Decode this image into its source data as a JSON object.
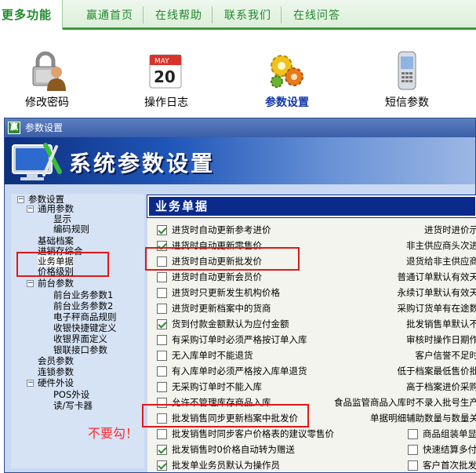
{
  "topnav": {
    "active": "更多功能",
    "items": [
      "赢通首页",
      "在线帮助",
      "联系我们",
      "在线问答"
    ]
  },
  "tools": [
    {
      "label": "修改密码",
      "icon": "lock-user-icon",
      "active": false
    },
    {
      "label": "操作日志",
      "icon": "calendar-icon",
      "active": false,
      "cal_month": "MAY",
      "cal_day": "20"
    },
    {
      "label": "参数设置",
      "icon": "gears-icon",
      "active": true
    },
    {
      "label": "短信参数",
      "icon": "mobile-phone-icon",
      "active": false
    }
  ],
  "window": {
    "title": "参数设置",
    "app_badge": "赢",
    "banner_title": "系统参数设置"
  },
  "tree": {
    "items": [
      {
        "label": "参数设置",
        "level": 0,
        "expander": "−"
      },
      {
        "label": "通用参数",
        "level": 1,
        "expander": "−"
      },
      {
        "label": "显示",
        "level": 2
      },
      {
        "label": "编码规则",
        "level": 2
      },
      {
        "label": "基础档案",
        "level": 1
      },
      {
        "label": "进销存综合",
        "level": 1
      },
      {
        "label": "业务单据",
        "level": 1,
        "selected": true
      },
      {
        "label": "价格级别",
        "level": 1
      },
      {
        "label": "前台参数",
        "level": 1,
        "expander": "−"
      },
      {
        "label": "前台业务参数1",
        "level": 2
      },
      {
        "label": "前台业务参数2",
        "level": 2
      },
      {
        "label": "电子秤商品规则",
        "level": 2
      },
      {
        "label": "收银快捷键定义",
        "level": 2
      },
      {
        "label": "收银界面定义",
        "level": 2
      },
      {
        "label": "银联接口参数",
        "level": 2
      },
      {
        "label": "会员参数",
        "level": 1
      },
      {
        "label": "连锁参数",
        "level": 1
      },
      {
        "label": "硬件外设",
        "level": 1,
        "expander": "−"
      },
      {
        "label": "POS外设",
        "level": 2
      },
      {
        "label": "读/写卡器",
        "level": 2
      }
    ]
  },
  "panel": {
    "header": "业务单据",
    "left_options": [
      {
        "label": "进货时自动更新参考进价",
        "checked": true
      },
      {
        "label": "进货时自动更新零售价",
        "checked": true
      },
      {
        "label": "进货时自动更新批发价",
        "checked": false
      },
      {
        "label": "进货时自动更新会员价",
        "checked": false
      },
      {
        "label": "进货时只更新发生机构价格",
        "checked": false
      },
      {
        "label": "进货时更新档案中的货商",
        "checked": false
      },
      {
        "label": "货到付款金额默认为应付金额",
        "checked": true
      },
      {
        "label": "有采购订单时必须严格按订单入库",
        "checked": false
      },
      {
        "label": "无入库单时不能退货",
        "checked": false
      },
      {
        "label": "有入库单时必须严格按入库单退货",
        "checked": false
      },
      {
        "label": "无采购订单时不能入库",
        "checked": false
      },
      {
        "label": "允许不管理库存商品入库",
        "checked": false
      },
      {
        "label": "批发销售同步更新档案中批发价",
        "checked": false
      },
      {
        "label": "批发销售时同步客户价格表的建议零售价",
        "checked": false
      },
      {
        "label": "批发销售时0价格自动转为赠送",
        "checked": true
      },
      {
        "label": "批发单业务员默认为操作员",
        "checked": true
      }
    ],
    "right_texts": [
      "进货时进价示",
      "非主供应商头次进",
      "退货给非主供应商",
      "普通订单默认有效天",
      "永续订单默认有效天",
      "采购订货单有在途数",
      "批发销售单默认不",
      "审核时操作日期作",
      "客户信誉不足时",
      "低于档案最低售价批",
      "高于档案进价采购",
      "食品监管商品入库时不录入批号生产",
      "单据明细辅助数量与数量关"
    ],
    "right_options": [
      {
        "label": "商品组装单显",
        "checked": false
      },
      {
        "label": "快速结算多付",
        "checked": false
      },
      {
        "label": "客户首次批发",
        "checked": false
      }
    ]
  },
  "annotation": {
    "warning": "不要勾！",
    "color": "#ff2a2a"
  }
}
